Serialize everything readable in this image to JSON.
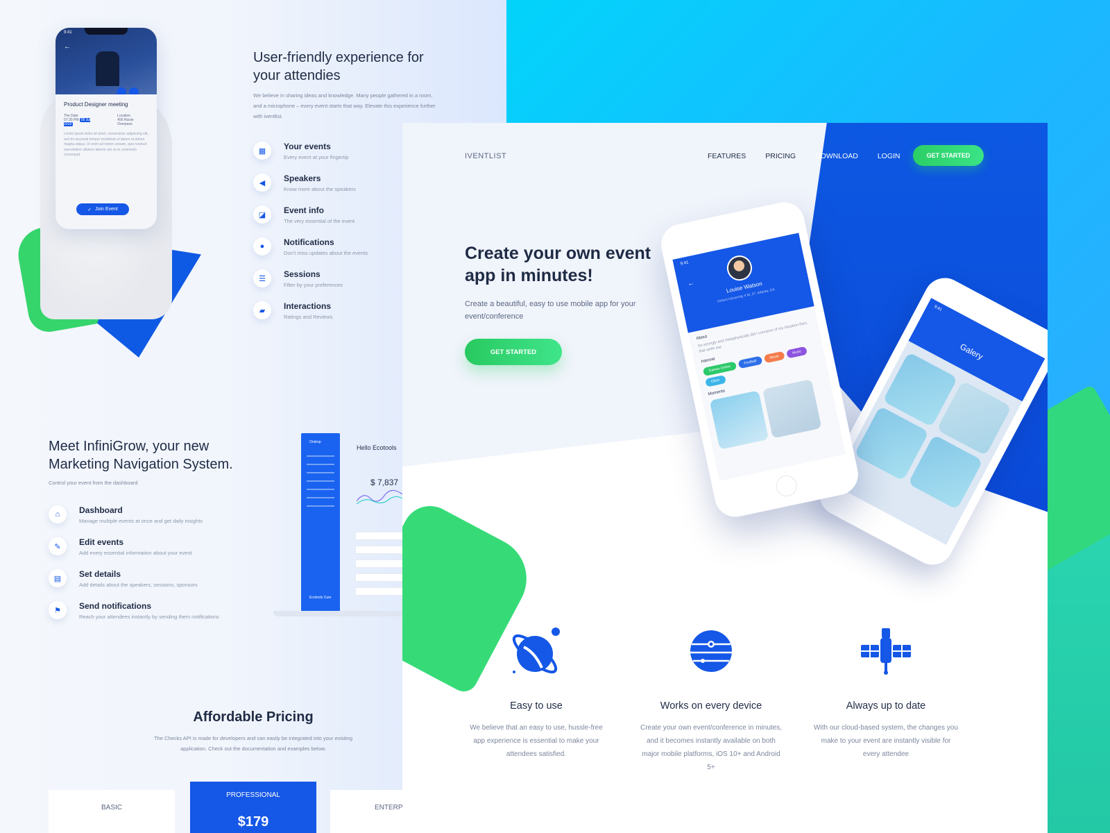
{
  "left": {
    "event_phone": {
      "time": "9:41",
      "title": "Product Designer meeting",
      "date_label": "The Date",
      "date_value": "07:30 PM",
      "date_tag": "05 Jul 2018",
      "location_label": "Location",
      "location_value": "456 Rizzie Overpass",
      "lorem": "Lorem ipsum dolor sit amet, consectetur adipiscing elit, sed do eiusmod tempor incididunt ut labore et dolore magna aliqua. Ut enim ad minim veniam, quis nostrud exercitation ullamco laboris nisi ut ex commodo consequat.",
      "join_label": "Join Event"
    },
    "attendees": {
      "title": "User-friendly experience for your attendies",
      "desc": "We believe in sharing ideas and knowledge. Many people gathered in a room, and a microphone – every event starts that way. Elevate this experience further with iventlist.",
      "features": [
        {
          "icon": "calendar-icon",
          "title": "Your events",
          "sub": "Every event at your fingertip"
        },
        {
          "icon": "megaphone-icon",
          "title": "Speakers",
          "sub": "Know more about the speakers"
        },
        {
          "icon": "info-icon",
          "title": "Event info",
          "sub": "The very essential of the event"
        },
        {
          "icon": "bell-icon",
          "title": "Notifications",
          "sub": "Don't miss updates about the events"
        },
        {
          "icon": "list-icon",
          "title": "Sessions",
          "sub": "Filter by your preferences"
        },
        {
          "icon": "chat-icon",
          "title": "Interactions",
          "sub": "Ratings and Reviews"
        }
      ]
    },
    "marketing": {
      "title": "Meet InfiniGrow, your new Marketing Navigation System.",
      "desc": "Control your event from the dashboard",
      "features": [
        {
          "icon": "home-icon",
          "title": "Dashboard",
          "sub": "Manage multiple events at once and get daily insights"
        },
        {
          "icon": "edit-icon",
          "title": "Edit events",
          "sub": "Add every essential information about your event"
        },
        {
          "icon": "details-icon",
          "title": "Set details",
          "sub": "Add details about the speakers, sessions, sponsors"
        },
        {
          "icon": "flag-icon",
          "title": "Send notifications",
          "sub": "Reach your attendees instantly by sending them notifications"
        }
      ]
    },
    "dashboard": {
      "brand": "Ondrop",
      "hello": "Hello Ecotools",
      "amount": "$ 7,837",
      "user": "Ecotools Care"
    },
    "pricing": {
      "title": "Affordable Pricing",
      "desc": "The Checks API is made for developers and can easily be integrated into your existing application. Check out the documentation and examples below.",
      "plans": [
        "BASIC",
        "PROFESSIONAL",
        "ENTERPR"
      ],
      "pro_price": "$179"
    }
  },
  "main": {
    "brand": "IVENTLIST",
    "nav": [
      "FEATURES",
      "PRICING",
      "DOWNLOAD",
      "LOGIN"
    ],
    "nav_cta": "GET STARTED",
    "hero_title": "Create your own event app in minutes!",
    "hero_desc": "Create a beautiful, easy to use mobile app for your event/conference",
    "hero_cta": "GET STARTED",
    "profile_phone": {
      "time": "9:41",
      "name": "Louise Watson",
      "location": "Oxford University II M, 27, Atlanta, GA",
      "about_label": "About",
      "about_text": "So strongly and metaphysically did I conceive of my situation then, that while ear.",
      "interest_label": "Interest",
      "chips": [
        {
          "label": "Games Online",
          "color": "#2cc96a"
        },
        {
          "label": "Football",
          "color": "#2f6fe8"
        },
        {
          "label": "Movie",
          "color": "#f47c4b"
        },
        {
          "label": "Music",
          "color": "#8d54e0"
        },
        {
          "label": "Other",
          "color": "#3cb5e8"
        }
      ],
      "moments_label": "Moments"
    },
    "gallery_phone": {
      "time": "9:41",
      "title": "Galery"
    },
    "features": [
      {
        "icon": "planet-icon",
        "title": "Easy to use",
        "desc": "We believe that an easy to use, hussle-free app experience is essential to make your attendees satisfied."
      },
      {
        "icon": "globe-icon",
        "title": "Works on every device",
        "desc": "Create your own event/conference in minutes, and it becomes instantly available on both major mobile platforms, iOS 10+ and Android 5+"
      },
      {
        "icon": "satellite-icon",
        "title": "Always up to date",
        "desc": "With our cloud-based system, the changes you make to your event are instantly visible for every attendee"
      }
    ]
  },
  "colors": {
    "primary_blue": "#1557e6",
    "green": "#36db78",
    "cyan": "#02d4fb",
    "text": "#1f2b45"
  }
}
